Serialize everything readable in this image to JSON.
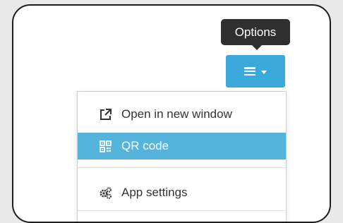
{
  "tooltip": {
    "text": "Options"
  },
  "options_button": {
    "icon": "hamburger-icon",
    "caret": "caret-down-icon"
  },
  "menu": {
    "items": [
      {
        "label": "Open in new window",
        "icon": "external-link-icon",
        "active": false
      },
      {
        "label": "QR code",
        "icon": "qr-code-icon",
        "active": true
      },
      {
        "label": "App settings",
        "icon": "gears-icon",
        "active": false
      }
    ]
  },
  "colors": {
    "accent": "#3ba9d9",
    "active_item": "#55b4dc",
    "tooltip_bg": "#2f2f2f",
    "background": "#e9e9ea"
  }
}
